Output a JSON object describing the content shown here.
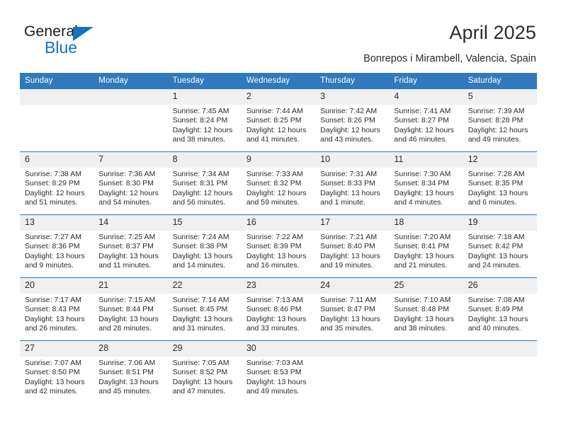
{
  "brand": {
    "word_one": "General",
    "word_two": "Blue",
    "accent_color": "#1573bd",
    "triangle_icon": "triangle-icon"
  },
  "header": {
    "month_title": "April 2025",
    "location": "Bonrepos i Mirambell, Valencia, Spain"
  },
  "theme": {
    "header_blue": "#3079bc",
    "daynum_band": "#f0f0f0",
    "text": "#2b2b2b"
  },
  "calendar": {
    "weekday_headers": [
      "Sunday",
      "Monday",
      "Tuesday",
      "Wednesday",
      "Thursday",
      "Friday",
      "Saturday"
    ],
    "weeks": [
      [
        {
          "day": "",
          "lines": []
        },
        {
          "day": "",
          "lines": []
        },
        {
          "day": "1",
          "lines": [
            "Sunrise: 7:45 AM",
            "Sunset: 8:24 PM",
            "Daylight: 12 hours",
            "and 38 minutes."
          ]
        },
        {
          "day": "2",
          "lines": [
            "Sunrise: 7:44 AM",
            "Sunset: 8:25 PM",
            "Daylight: 12 hours",
            "and 41 minutes."
          ]
        },
        {
          "day": "3",
          "lines": [
            "Sunrise: 7:42 AM",
            "Sunset: 8:26 PM",
            "Daylight: 12 hours",
            "and 43 minutes."
          ]
        },
        {
          "day": "4",
          "lines": [
            "Sunrise: 7:41 AM",
            "Sunset: 8:27 PM",
            "Daylight: 12 hours",
            "and 46 minutes."
          ]
        },
        {
          "day": "5",
          "lines": [
            "Sunrise: 7:39 AM",
            "Sunset: 8:28 PM",
            "Daylight: 12 hours",
            "and 49 minutes."
          ]
        }
      ],
      [
        {
          "day": "6",
          "lines": [
            "Sunrise: 7:38 AM",
            "Sunset: 8:29 PM",
            "Daylight: 12 hours",
            "and 51 minutes."
          ]
        },
        {
          "day": "7",
          "lines": [
            "Sunrise: 7:36 AM",
            "Sunset: 8:30 PM",
            "Daylight: 12 hours",
            "and 54 minutes."
          ]
        },
        {
          "day": "8",
          "lines": [
            "Sunrise: 7:34 AM",
            "Sunset: 8:31 PM",
            "Daylight: 12 hours",
            "and 56 minutes."
          ]
        },
        {
          "day": "9",
          "lines": [
            "Sunrise: 7:33 AM",
            "Sunset: 8:32 PM",
            "Daylight: 12 hours",
            "and 59 minutes."
          ]
        },
        {
          "day": "10",
          "lines": [
            "Sunrise: 7:31 AM",
            "Sunset: 8:33 PM",
            "Daylight: 13 hours",
            "and 1 minute."
          ]
        },
        {
          "day": "11",
          "lines": [
            "Sunrise: 7:30 AM",
            "Sunset: 8:34 PM",
            "Daylight: 13 hours",
            "and 4 minutes."
          ]
        },
        {
          "day": "12",
          "lines": [
            "Sunrise: 7:28 AM",
            "Sunset: 8:35 PM",
            "Daylight: 13 hours",
            "and 6 minutes."
          ]
        }
      ],
      [
        {
          "day": "13",
          "lines": [
            "Sunrise: 7:27 AM",
            "Sunset: 8:36 PM",
            "Daylight: 13 hours",
            "and 9 minutes."
          ]
        },
        {
          "day": "14",
          "lines": [
            "Sunrise: 7:25 AM",
            "Sunset: 8:37 PM",
            "Daylight: 13 hours",
            "and 11 minutes."
          ]
        },
        {
          "day": "15",
          "lines": [
            "Sunrise: 7:24 AM",
            "Sunset: 8:38 PM",
            "Daylight: 13 hours",
            "and 14 minutes."
          ]
        },
        {
          "day": "16",
          "lines": [
            "Sunrise: 7:22 AM",
            "Sunset: 8:39 PM",
            "Daylight: 13 hours",
            "and 16 minutes."
          ]
        },
        {
          "day": "17",
          "lines": [
            "Sunrise: 7:21 AM",
            "Sunset: 8:40 PM",
            "Daylight: 13 hours",
            "and 19 minutes."
          ]
        },
        {
          "day": "18",
          "lines": [
            "Sunrise: 7:20 AM",
            "Sunset: 8:41 PM",
            "Daylight: 13 hours",
            "and 21 minutes."
          ]
        },
        {
          "day": "19",
          "lines": [
            "Sunrise: 7:18 AM",
            "Sunset: 8:42 PM",
            "Daylight: 13 hours",
            "and 24 minutes."
          ]
        }
      ],
      [
        {
          "day": "20",
          "lines": [
            "Sunrise: 7:17 AM",
            "Sunset: 8:43 PM",
            "Daylight: 13 hours",
            "and 26 minutes."
          ]
        },
        {
          "day": "21",
          "lines": [
            "Sunrise: 7:15 AM",
            "Sunset: 8:44 PM",
            "Daylight: 13 hours",
            "and 28 minutes."
          ]
        },
        {
          "day": "22",
          "lines": [
            "Sunrise: 7:14 AM",
            "Sunset: 8:45 PM",
            "Daylight: 13 hours",
            "and 31 minutes."
          ]
        },
        {
          "day": "23",
          "lines": [
            "Sunrise: 7:13 AM",
            "Sunset: 8:46 PM",
            "Daylight: 13 hours",
            "and 33 minutes."
          ]
        },
        {
          "day": "24",
          "lines": [
            "Sunrise: 7:11 AM",
            "Sunset: 8:47 PM",
            "Daylight: 13 hours",
            "and 35 minutes."
          ]
        },
        {
          "day": "25",
          "lines": [
            "Sunrise: 7:10 AM",
            "Sunset: 8:48 PM",
            "Daylight: 13 hours",
            "and 38 minutes."
          ]
        },
        {
          "day": "26",
          "lines": [
            "Sunrise: 7:08 AM",
            "Sunset: 8:49 PM",
            "Daylight: 13 hours",
            "and 40 minutes."
          ]
        }
      ],
      [
        {
          "day": "27",
          "lines": [
            "Sunrise: 7:07 AM",
            "Sunset: 8:50 PM",
            "Daylight: 13 hours",
            "and 42 minutes."
          ]
        },
        {
          "day": "28",
          "lines": [
            "Sunrise: 7:06 AM",
            "Sunset: 8:51 PM",
            "Daylight: 13 hours",
            "and 45 minutes."
          ]
        },
        {
          "day": "29",
          "lines": [
            "Sunrise: 7:05 AM",
            "Sunset: 8:52 PM",
            "Daylight: 13 hours",
            "and 47 minutes."
          ]
        },
        {
          "day": "30",
          "lines": [
            "Sunrise: 7:03 AM",
            "Sunset: 8:53 PM",
            "Daylight: 13 hours",
            "and 49 minutes."
          ]
        },
        {
          "day": "",
          "lines": []
        },
        {
          "day": "",
          "lines": []
        },
        {
          "day": "",
          "lines": []
        }
      ]
    ]
  }
}
